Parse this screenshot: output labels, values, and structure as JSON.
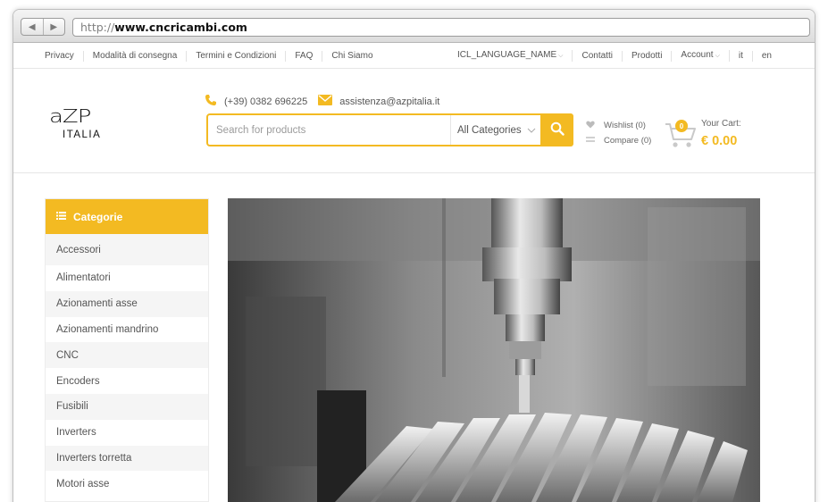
{
  "browser": {
    "back_label": "◀",
    "forward_label": "▶",
    "url_prefix": "http://",
    "url_domain": "www.cncricambi.com"
  },
  "top_links": {
    "left": [
      "Privacy",
      "Modalità di consegna",
      "Termini e Condizioni",
      "FAQ",
      "Chi Siamo"
    ],
    "right": [
      "ICL_LANGUAGE_NAME",
      "Contatti",
      "Prodotti",
      "Account",
      "it",
      "en"
    ]
  },
  "header": {
    "logo_main": "aZP",
    "logo_sub": "ITALIA",
    "phone": "(+39) 0382 696225",
    "email": "assistenza@azpitalia.it",
    "search_placeholder": "Search for products",
    "category_select": "All Categories",
    "wishlist": "Wishlist (0)",
    "compare": "Compare (0)",
    "cart_count": "0",
    "cart_label": "Your Cart:",
    "cart_total": "€ 0.00"
  },
  "categories": {
    "title": "Categorie",
    "items": [
      "Accessori",
      "Alimentatori",
      "Azionamenti asse",
      "Azionamenti mandrino",
      "CNC",
      "Encoders",
      "Fusibili",
      "Inverters",
      "Inverters torretta",
      "Motori asse"
    ]
  },
  "hero": {
    "alt": "CNC machine spindle milling turbine blades"
  },
  "colors": {
    "accent": "#f3ba22",
    "text": "#555555",
    "border": "#e6e6e6"
  }
}
